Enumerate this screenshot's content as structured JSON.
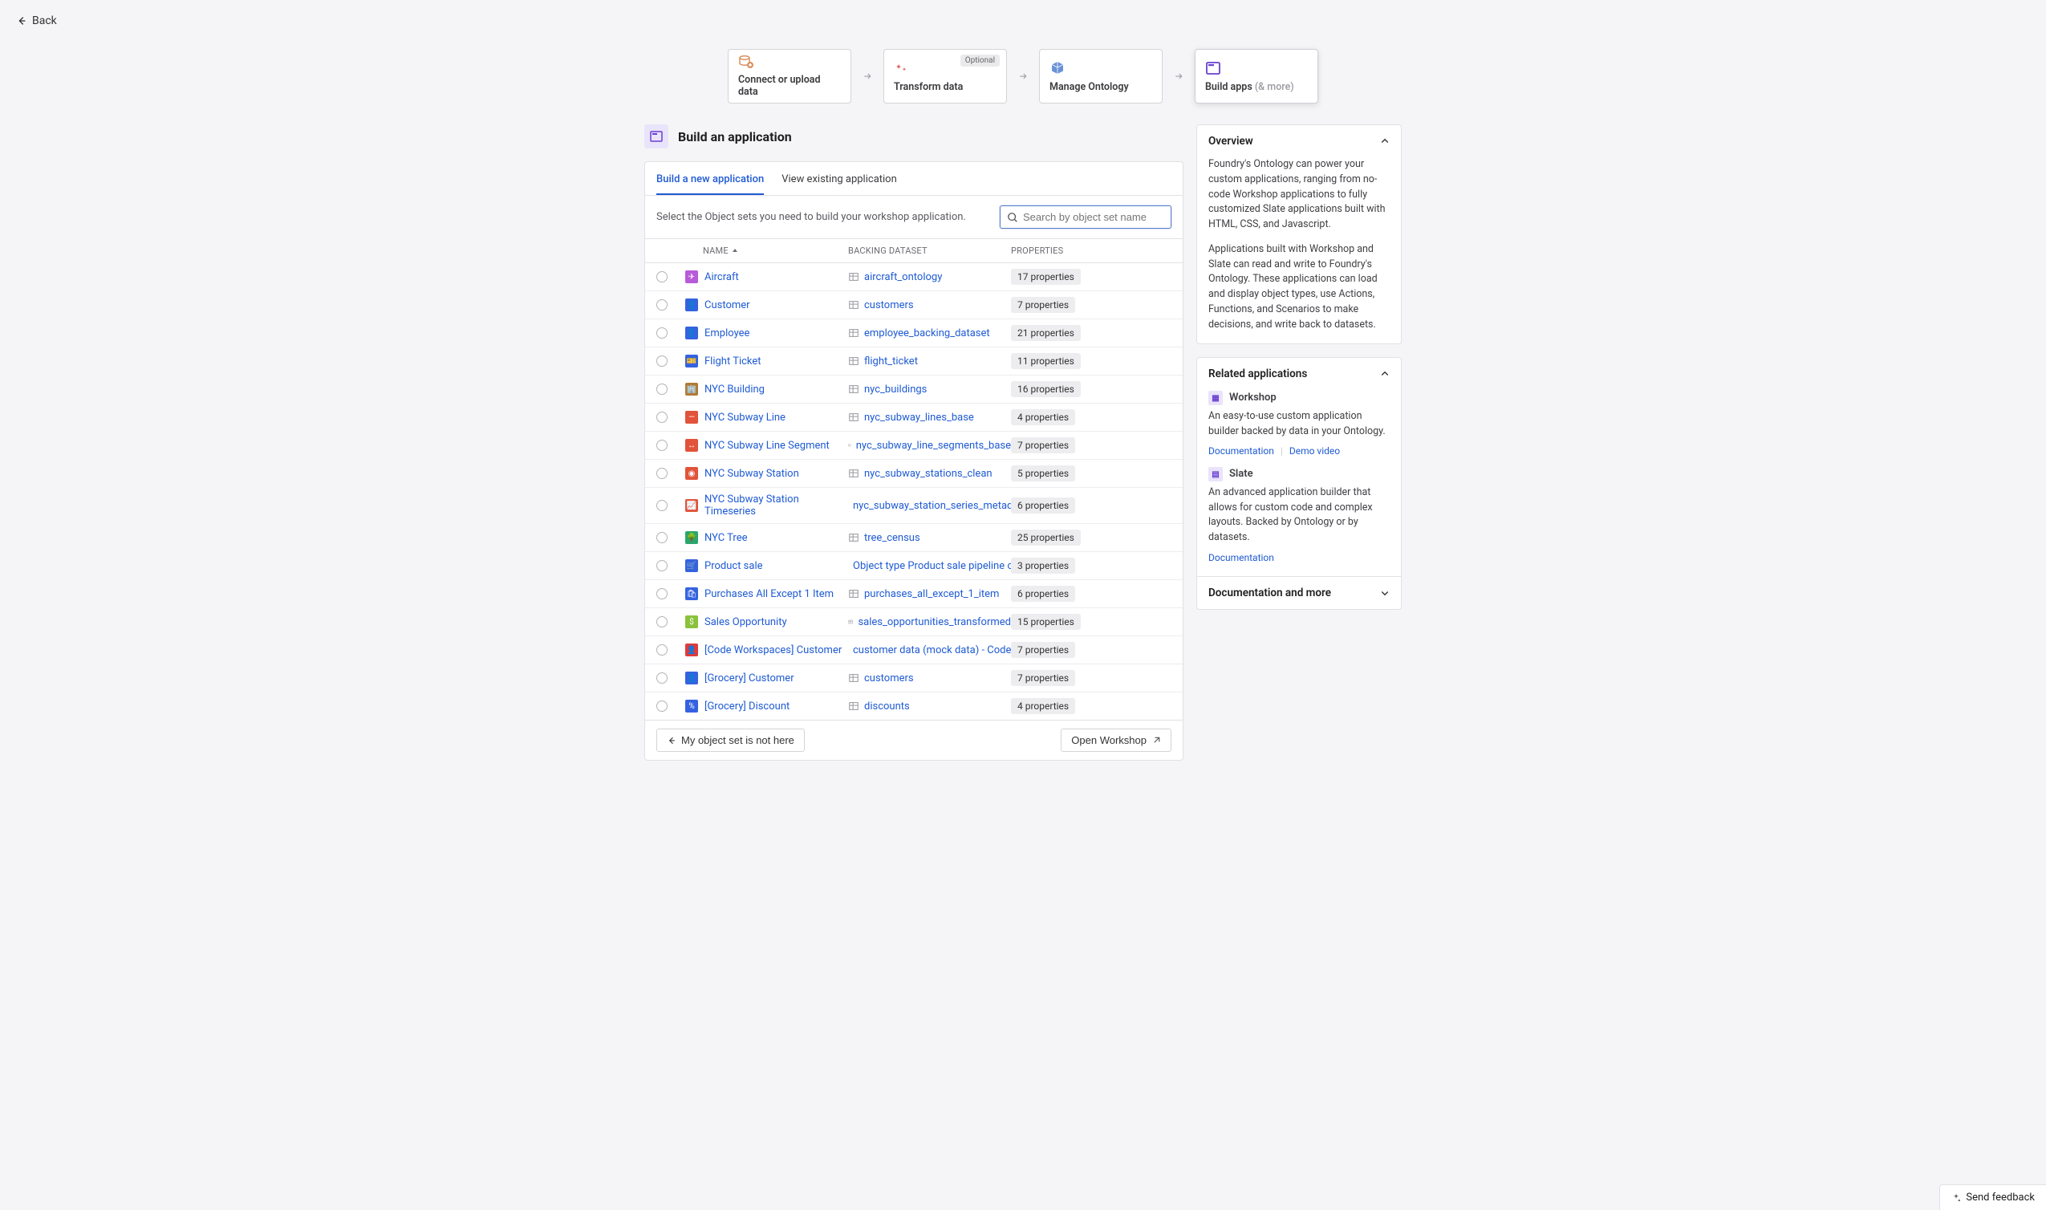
{
  "back_label": "Back",
  "stepper": [
    {
      "label": "Connect or upload data",
      "icon": "database-plus",
      "color": "#d89060"
    },
    {
      "label": "Transform data",
      "icon": "sparkle",
      "color": "#e16a6a",
      "optional": "Optional"
    },
    {
      "label": "Manage Ontology",
      "icon": "cube",
      "color": "#5a86d1"
    },
    {
      "label": "Build apps",
      "sub": "(& more)",
      "icon": "app",
      "color": "#6a3fd1",
      "active": true
    }
  ],
  "page_title": "Build an application",
  "tabs": {
    "build": "Build a new application",
    "view": "View existing application"
  },
  "hint": "Select the Object sets you need to build your workshop application.",
  "search_placeholder": "Search by object set name",
  "columns": {
    "name": "NAME",
    "backing": "BACKING DATASET",
    "props": "PROPERTIES"
  },
  "rows": [
    {
      "name": "Aircraft",
      "icon_bg": "#b85bd8",
      "icon_glyph": "✈",
      "dataset": "aircraft_ontology",
      "props": "17 properties"
    },
    {
      "name": "Customer",
      "icon_bg": "#3462e0",
      "icon_glyph": "👤",
      "dataset": "customers",
      "props": "7 properties"
    },
    {
      "name": "Employee",
      "icon_bg": "#3462e0",
      "icon_glyph": "👤",
      "dataset": "employee_backing_dataset",
      "props": "21 properties"
    },
    {
      "name": "Flight Ticket",
      "icon_bg": "#3462e0",
      "icon_glyph": "🎫",
      "dataset": "flight_ticket",
      "props": "11 properties"
    },
    {
      "name": "NYC Building",
      "icon_bg": "#b07a36",
      "icon_glyph": "🏢",
      "dataset": "nyc_buildings",
      "props": "16 properties"
    },
    {
      "name": "NYC Subway Line",
      "icon_bg": "#e1533a",
      "icon_glyph": "—",
      "dataset": "nyc_subway_lines_base",
      "props": "4 properties"
    },
    {
      "name": "NYC Subway Line Segment",
      "icon_bg": "#e1533a",
      "icon_glyph": "↔",
      "dataset": "nyc_subway_line_segments_base",
      "props": "7 properties"
    },
    {
      "name": "NYC Subway Station",
      "icon_bg": "#e1533a",
      "icon_glyph": "◉",
      "dataset": "nyc_subway_stations_clean",
      "props": "5 properties"
    },
    {
      "name": "NYC Subway Station Timeseries",
      "icon_bg": "#e1533a",
      "icon_glyph": "📈",
      "dataset": "nyc_subway_station_series_metadata",
      "props": "6 properties"
    },
    {
      "name": "NYC Tree",
      "icon_bg": "#2aa66b",
      "icon_glyph": "🌳",
      "dataset": "tree_census",
      "props": "25 properties"
    },
    {
      "name": "Product sale",
      "icon_bg": "#3462e0",
      "icon_glyph": "🛒",
      "dataset": "Object type Product sale pipeline outp",
      "props": "3 properties"
    },
    {
      "name": "Purchases All Except 1 Item",
      "icon_bg": "#3462e0",
      "icon_glyph": "🛍",
      "dataset": "purchases_all_except_1_item",
      "props": "6 properties"
    },
    {
      "name": "Sales Opportunity",
      "icon_bg": "#8ac23c",
      "icon_glyph": "$",
      "dataset": "sales_opportunities_transformed",
      "props": "15 properties"
    },
    {
      "name": "[Code Workspaces] Customer",
      "icon_bg": "#e03a3a",
      "icon_glyph": "👤",
      "dataset": "customer data (mock data) - Code Wor",
      "props": "7 properties"
    },
    {
      "name": "[Grocery] Customer",
      "icon_bg": "#3462e0",
      "icon_glyph": "👤",
      "dataset": "customers",
      "props": "7 properties"
    },
    {
      "name": "[Grocery] Discount",
      "icon_bg": "#3462e0",
      "icon_glyph": "%",
      "dataset": "discounts",
      "props": "4 properties"
    }
  ],
  "footer": {
    "not_here": "My object set is not here",
    "open_workshop": "Open Workshop"
  },
  "overview": {
    "title": "Overview",
    "p1": "Foundry's Ontology can power your custom applications, ranging from no-code Workshop applications to fully customized Slate applications built with HTML, CSS, and Javascript.",
    "p2": "Applications built with Workshop and Slate can read and write to Foundry's Ontology. These applications can load and display object types, use Actions, Functions, and Scenarios to make decisions, and write back to datasets."
  },
  "related": {
    "title": "Related applications",
    "workshop": {
      "name": "Workshop",
      "desc": "An easy-to-use custom application builder backed by data in your Ontology.",
      "doc": "Documentation",
      "demo": "Demo video"
    },
    "slate": {
      "name": "Slate",
      "desc": "An advanced application builder that allows for custom code and complex layouts. Backed by Ontology or by datasets.",
      "doc": "Documentation"
    }
  },
  "doc_more": "Documentation and more",
  "feedback": "Send feedback"
}
